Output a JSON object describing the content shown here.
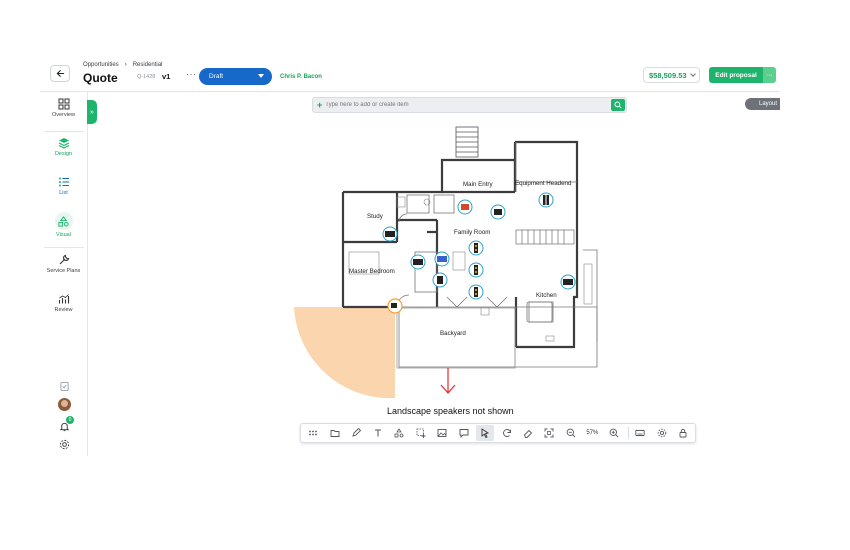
{
  "header": {
    "breadcrumb": [
      "Opportunities",
      "Residential"
    ],
    "title": "Quote",
    "quote_number": "Q-1428",
    "version": "v1",
    "status": "Draft",
    "owner": "Chris P. Bacon",
    "total": "$58,509.53",
    "edit_label": "Edit proposal",
    "more_dots": "···"
  },
  "sidebar": {
    "items": [
      {
        "label": "Overview",
        "icon": "grid-icon"
      },
      {
        "label": "Design",
        "icon": "layers-icon",
        "active": true
      },
      {
        "label": "List",
        "icon": "list-icon"
      },
      {
        "label": "Visual",
        "icon": "shapes-icon",
        "active": true
      },
      {
        "label": "Service Plans",
        "icon": "wrench-icon"
      },
      {
        "label": "Review",
        "icon": "chart-icon"
      }
    ],
    "notification_count": "0"
  },
  "search": {
    "placeholder": "Type here to add or create item"
  },
  "layout_button": "Layout",
  "floorplan": {
    "rooms": [
      "Main Entry",
      "Equipment Headend",
      "Study",
      "Family Room",
      "Master Bedroom",
      "Kitchen",
      "Backyard"
    ],
    "caption": "Landscape speakers not shown"
  },
  "toolbar": {
    "zoom": "57%"
  },
  "colors": {
    "brand_green": "#1db56c",
    "status_blue": "#1769c9",
    "price_green": "#17a35a",
    "camera_cone": "#fbd5ad"
  }
}
